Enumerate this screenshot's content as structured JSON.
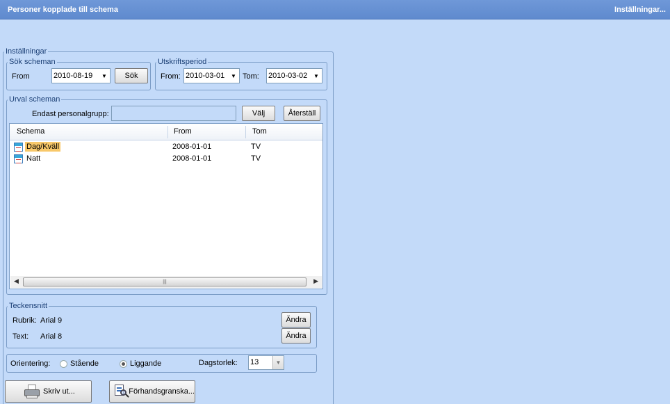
{
  "titlebar": {
    "title": "Personer kopplade till schema",
    "settings_link": "Inställningar..."
  },
  "settings": {
    "legend": "Inställningar",
    "search": {
      "legend": "Sök scheman",
      "from_label": "From",
      "from_value": "2010-08-19",
      "search_button": "Sök"
    },
    "print_period": {
      "legend": "Utskriftsperiod",
      "from_label": "From:",
      "from_value": "2010-03-01",
      "to_label": "Tom:",
      "to_value": "2010-03-02"
    },
    "selection": {
      "legend": "Urval scheman",
      "group_label": "Endast personalgrupp:",
      "group_value": "",
      "choose_button": "Välj",
      "reset_button": "Återställ",
      "columns": [
        "Schema",
        "From",
        "Tom"
      ],
      "rows": [
        {
          "schema": "Dag/Kväll",
          "from": "2008-01-01",
          "tom": "TV",
          "selected": true
        },
        {
          "schema": "Natt",
          "from": "2008-01-01",
          "tom": "TV",
          "selected": false
        }
      ]
    },
    "font": {
      "legend": "Teckensnitt",
      "heading_label": "Rubrik:",
      "heading_value": "Arial 9",
      "text_label": "Text:",
      "text_value": "Arial 8",
      "change_button": "Ändra"
    },
    "orientation": {
      "label": "Orientering:",
      "portrait": "Stående",
      "landscape": "Liggande",
      "selected": "landscape",
      "day_size_label": "Dagstorlek:",
      "day_size_value": "13"
    }
  },
  "actions": {
    "print": "Skriv ut...",
    "preview": "Förhandsgranska..."
  },
  "icons": {
    "dropdown": "chevron-down-icon",
    "schedule": "calendar-icon",
    "print": "printer-icon",
    "preview": "print-preview-icon"
  }
}
